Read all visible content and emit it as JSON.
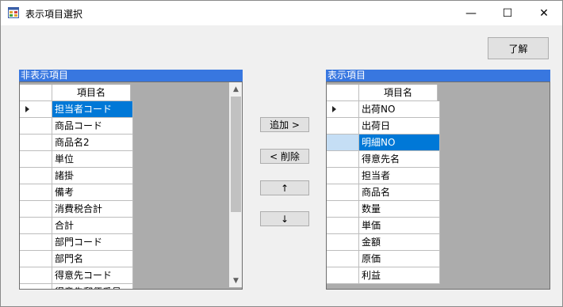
{
  "window": {
    "title": "表示項目選択"
  },
  "titlebar_buttons": {
    "minimize": "—",
    "maximize": "☐",
    "close": "✕"
  },
  "ok_button": "了解",
  "left_panel": {
    "caption": "非表示項目",
    "column_header": "項目名",
    "rows": [
      "担当者コード",
      "商品コード",
      "商品名2",
      "単位",
      "諸掛",
      "備考",
      "消費税合計",
      "合計",
      "部門コード",
      "部門名",
      "得意先コード",
      "得意先郵便番号"
    ],
    "selected_index": 0
  },
  "middle_buttons": {
    "add": "追加 >",
    "remove": "< 削除",
    "up": "↑",
    "down": "↓"
  },
  "right_panel": {
    "caption": "表示項目",
    "column_header": "項目名",
    "rows": [
      "出荷NO",
      "出荷日",
      "明細NO",
      "得意先名",
      "担当者",
      "商品名",
      "数量",
      "単価",
      "金額",
      "原価",
      "利益"
    ],
    "current_index": 0,
    "selected_index": 2
  },
  "colors": {
    "caption_bg": "#3877e0",
    "selection": "#0078d7",
    "grid_bg": "#acacac"
  }
}
